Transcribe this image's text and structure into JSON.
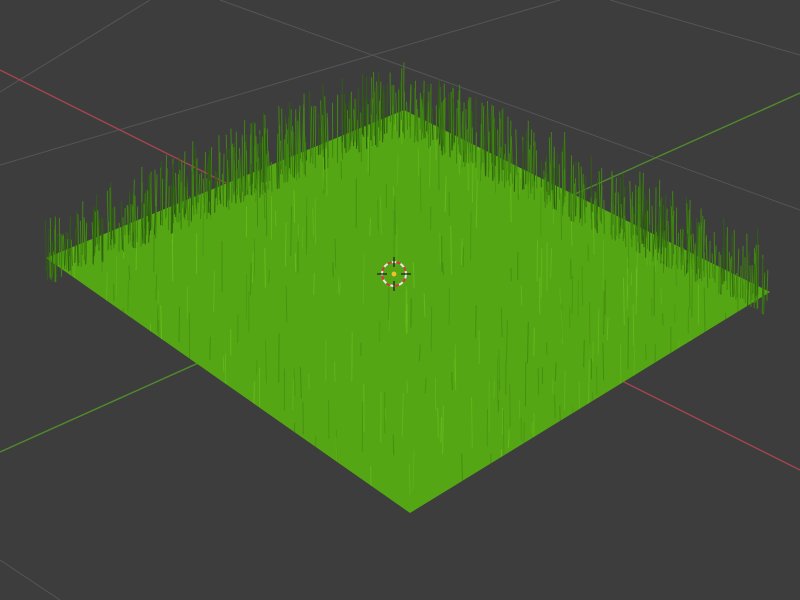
{
  "viewport": {
    "background_color": "#3d3d3d",
    "grid_line_color": "#555555",
    "x_axis_color": "#a3464f",
    "y_axis_color": "#4f8a2c"
  },
  "scene": {
    "object": {
      "kind": "grass-patch",
      "fill_color": "#55a614",
      "blade_color": "#3f8410",
      "blade_highlight_color": "#6cc21f"
    },
    "cursor_3d": {
      "icon": "3d-cursor-icon",
      "ring_colors": [
        "#e8e8e8",
        "#d9363e"
      ],
      "center_color": "#f0c030"
    }
  }
}
